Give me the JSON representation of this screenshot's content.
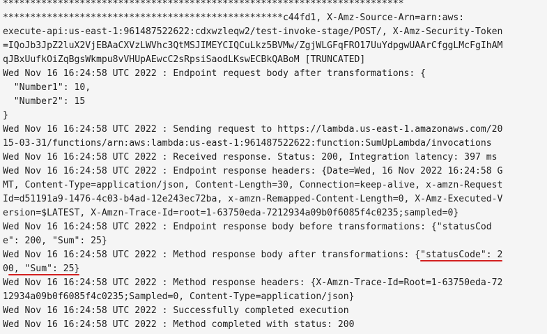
{
  "log": {
    "lines": [
      "*************************************************************************",
      "***************************************************c44fd1, X-Amz-Source-Arn=arn:aws:",
      "execute-api:us-east-1:961487522622:cdxwzleqw2/test-invoke-stage/POST/, X-Amz-Security-Token",
      "=IQoJb3JpZ2luX2VjEBAaCXVzLWVhc3QtMSJIMEYCIQCuLkz5BVMw/ZgjWLGFqFRO17UuYdpgwUAArCfggLMcFgIhAM",
      "qJBxUufkOiZqBgsWkmpu8vVHUpAEwcC2sRpsiSaodLKswECBkQABoM [TRUNCATED]",
      "Wed Nov 16 16:24:58 UTC 2022 : Endpoint request body after transformations: {",
      "  \"Number1\": 10,",
      "  \"Number2\": 15",
      "}",
      "Wed Nov 16 16:24:58 UTC 2022 : Sending request to https://lambda.us-east-1.amazonaws.com/20",
      "15-03-31/functions/arn:aws:lambda:us-east-1:961487522622:function:SumUpLambda/invocations",
      "Wed Nov 16 16:24:58 UTC 2022 : Received response. Status: 200, Integration latency: 397 ms",
      "Wed Nov 16 16:24:58 UTC 2022 : Endpoint response headers: {Date=Wed, 16 Nov 2022 16:24:58 G",
      "MT, Content-Type=application/json, Content-Length=30, Connection=keep-alive, x-amzn-Request",
      "Id=d51191a9-1476-4c03-b4ad-12e243ec72ba, x-amzn-Remapped-Content-Length=0, X-Amz-Executed-V",
      "ersion=$LATEST, X-Amzn-Trace-Id=root=1-63750eda-7212934a09b0f6085f4c0235;sampled=0}",
      "Wed Nov 16 16:24:58 UTC 2022 : Endpoint response body before transformations: {\"statusCod",
      "e\": 200, \"Sum\": 25}"
    ],
    "hl_line1_prefix": "Wed Nov 16 16:24:58 UTC 2022 : Method response body after transformations: {",
    "hl_line1_mark": "\"statusCode\": 2",
    "hl_line2_prefix": "0",
    "hl_line2_mark": "0, \"Sum\": 25}",
    "lines_after": [
      "Wed Nov 16 16:24:58 UTC 2022 : Method response headers: {X-Amzn-Trace-Id=Root=1-63750eda-72",
      "12934a09b0f6085f4c0235;Sampled=0, Content-Type=application/json}",
      "Wed Nov 16 16:24:58 UTC 2022 : Successfully completed execution",
      "Wed Nov 16 16:24:58 UTC 2022 : Method completed with status: 200"
    ]
  },
  "colors": {
    "background": "#f5f5f5",
    "text": "#1f1f1f",
    "annotation": "#d21f1f"
  }
}
